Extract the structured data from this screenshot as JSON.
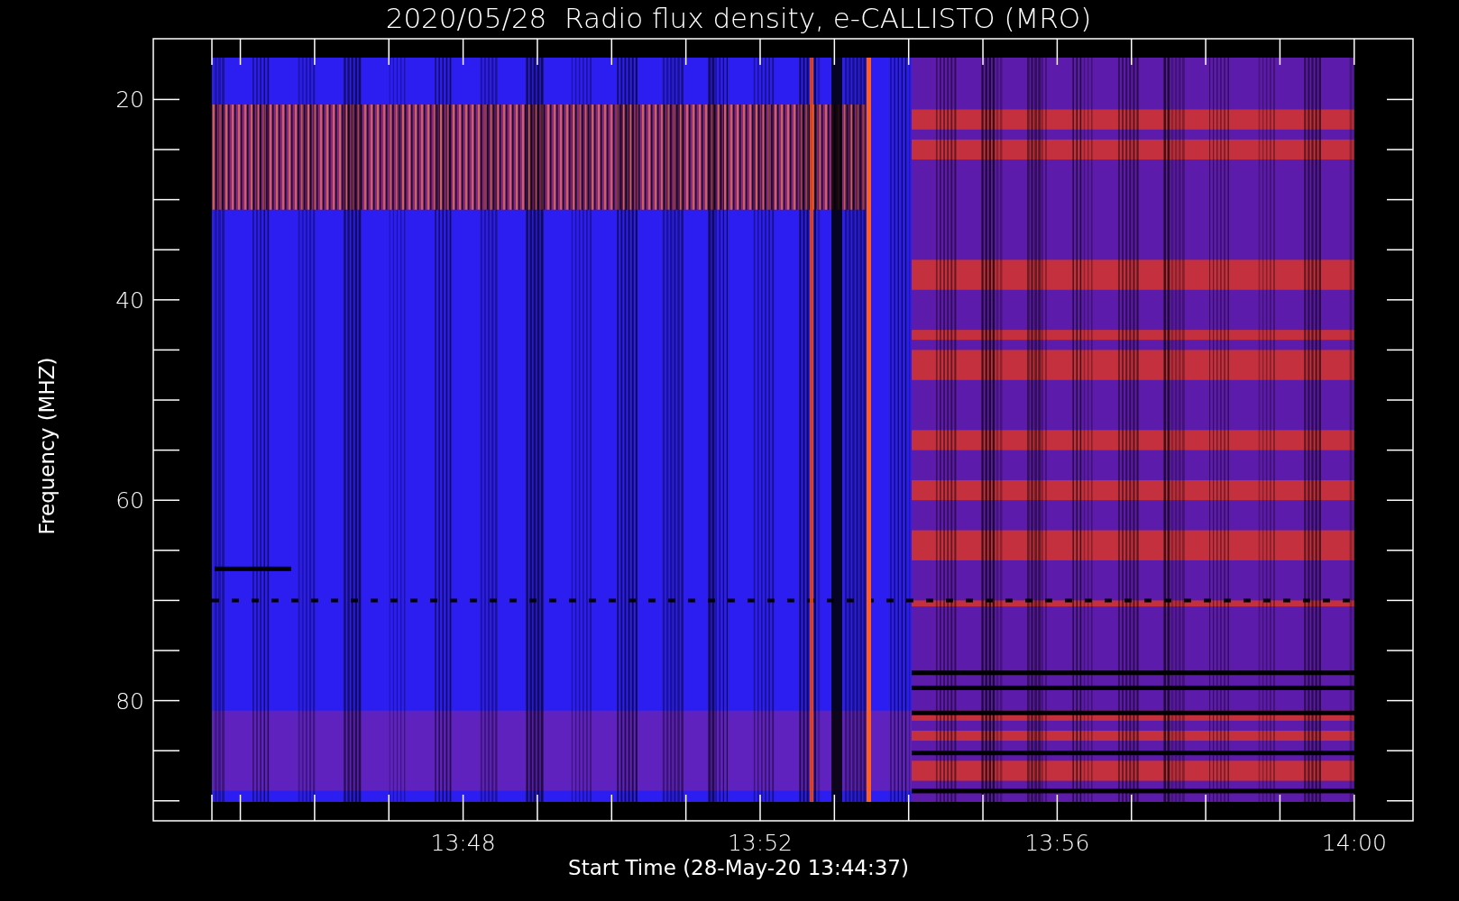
{
  "plot": {
    "title": "2020/05/28  Radio flux density, e-CALLISTO (MRO)",
    "ylabel": "Frequency (MHZ)",
    "xlabel": "Start Time (28-May-20 13:44:37)",
    "yticks": [
      "20",
      "40",
      "60",
      "80"
    ],
    "xticks": [
      "13:48",
      "13:52",
      "13:56",
      "14:00"
    ]
  }
}
